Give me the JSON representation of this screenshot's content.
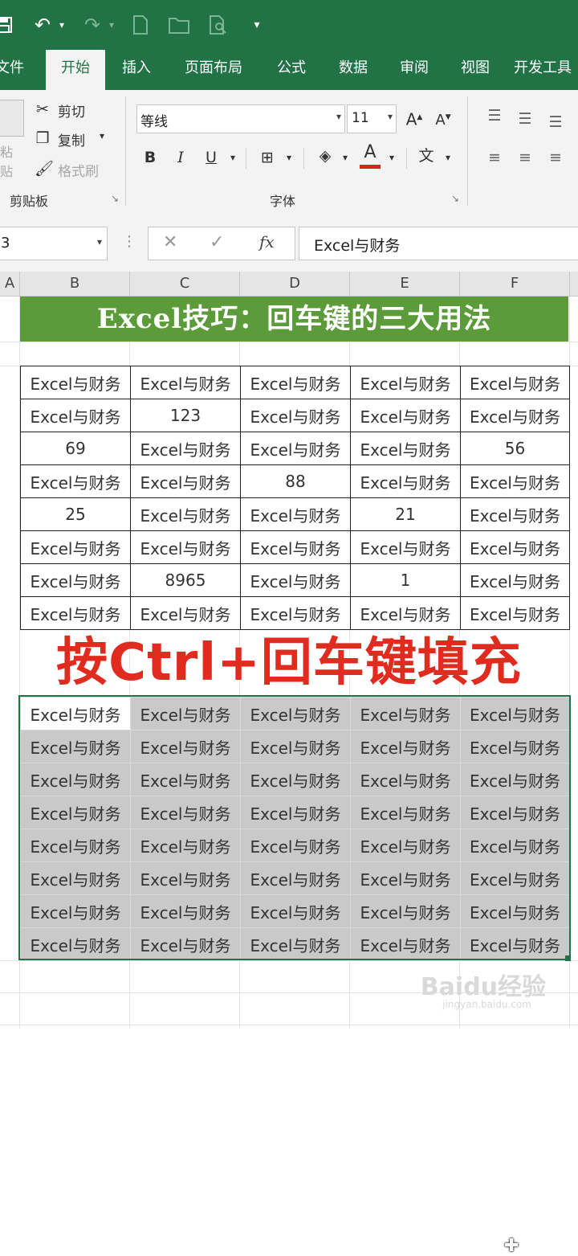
{
  "quick_access": {
    "icons": [
      "save-icon",
      "undo-icon",
      "redo-icon",
      "new-file-icon",
      "open-folder-icon",
      "print-preview-icon",
      "customize-icon"
    ]
  },
  "tabs": [
    {
      "label": "文件",
      "active": false
    },
    {
      "label": "开始",
      "active": true
    },
    {
      "label": "插入",
      "active": false
    },
    {
      "label": "页面布局",
      "active": false
    },
    {
      "label": "公式",
      "active": false
    },
    {
      "label": "数据",
      "active": false
    },
    {
      "label": "审阅",
      "active": false
    },
    {
      "label": "视图",
      "active": false
    },
    {
      "label": "开发工具",
      "active": false
    }
  ],
  "ribbon": {
    "clipboard": {
      "paste_label": "粘贴",
      "cut_label": "剪切",
      "copy_label": "复制",
      "format_painter_label": "格式刷",
      "group_label": "剪贴板"
    },
    "font": {
      "font_name": "等线",
      "font_size": "11",
      "grow_label": "A",
      "shrink_label": "A",
      "bold": "B",
      "italic": "I",
      "underline": "U",
      "font_color_label": "A",
      "phonetic_label": "文",
      "group_label": "字体",
      "font_color": "#e0201a"
    }
  },
  "formula_bar": {
    "name_box": "3",
    "fx_label": "fx",
    "content": "Excel与财务"
  },
  "columns": [
    "A",
    "B",
    "C",
    "D",
    "E",
    "F"
  ],
  "sheet": {
    "banner_title": "Excel技巧：回车键的三大用法",
    "table1": [
      [
        "Excel与财务",
        "Excel与财务",
        "Excel与财务",
        "Excel与财务",
        "Excel与财务"
      ],
      [
        "Excel与财务",
        "123",
        "Excel与财务",
        "Excel与财务",
        "Excel与财务"
      ],
      [
        "69",
        "Excel与财务",
        "Excel与财务",
        "Excel与财务",
        "56"
      ],
      [
        "Excel与财务",
        "Excel与财务",
        "88",
        "Excel与财务",
        "Excel与财务"
      ],
      [
        "25",
        "Excel与财务",
        "Excel与财务",
        "21",
        "Excel与财务"
      ],
      [
        "Excel与财务",
        "Excel与财务",
        "Excel与财务",
        "Excel与财务",
        "Excel与财务"
      ],
      [
        "Excel与财务",
        "8965",
        "Excel与财务",
        "1",
        "Excel与财务"
      ],
      [
        "Excel与财务",
        "Excel与财务",
        "Excel与财务",
        "Excel与财务",
        "Excel与财务"
      ]
    ],
    "caption": "按Ctrl+回车键填充",
    "table2": [
      [
        "Excel与财务",
        "Excel与财务",
        "Excel与财务",
        "Excel与财务",
        "Excel与财务"
      ],
      [
        "Excel与财务",
        "Excel与财务",
        "Excel与财务",
        "Excel与财务",
        "Excel与财务"
      ],
      [
        "Excel与财务",
        "Excel与财务",
        "Excel与财务",
        "Excel与财务",
        "Excel与财务"
      ],
      [
        "Excel与财务",
        "Excel与财务",
        "Excel与财务",
        "Excel与财务",
        "Excel与财务"
      ],
      [
        "Excel与财务",
        "Excel与财务",
        "Excel与财务",
        "Excel与财务",
        "Excel与财务"
      ],
      [
        "Excel与财务",
        "Excel与财务",
        "Excel与财务",
        "Excel与财务",
        "Excel与财务"
      ],
      [
        "Excel与财务",
        "Excel与财务",
        "Excel与财务",
        "Excel与财务",
        "Excel与财务"
      ],
      [
        "Excel与财务",
        "Excel与财务",
        "Excel与财务",
        "Excel与财务",
        "Excel与财务"
      ]
    ]
  },
  "watermark": {
    "text": "Baidu经验",
    "sub": "jingyan.baidu.com"
  },
  "colors": {
    "excel_green": "#217346",
    "banner_green": "#5b9b3a",
    "caption_red": "#e02b1f",
    "selection_gray": "#c9c9c9"
  }
}
